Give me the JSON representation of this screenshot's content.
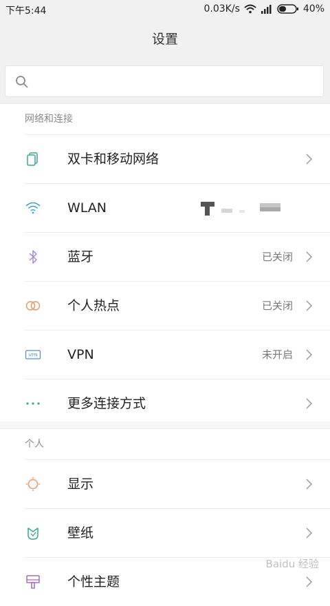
{
  "status_bar": {
    "time": "下午5:44",
    "network_speed": "0.03K/s",
    "battery": "40%"
  },
  "title": "设置",
  "search": {
    "placeholder": ""
  },
  "sections": [
    {
      "header": "网络和连接",
      "items": [
        {
          "label": "双卡和移动网络",
          "value": "",
          "icon": "sim-card-icon",
          "color": "#3fa39a"
        },
        {
          "label": "WLAN",
          "value": "",
          "icon": "wifi-icon",
          "color": "#3fa0c6"
        },
        {
          "label": "蓝牙",
          "value": "已关闭",
          "icon": "bluetooth-icon",
          "color": "#a889d4"
        },
        {
          "label": "个人热点",
          "value": "已关闭",
          "icon": "hotspot-icon",
          "color": "#e9986b"
        },
        {
          "label": "VPN",
          "value": "未开启",
          "icon": "vpn-icon",
          "color": "#5a8fc6"
        },
        {
          "label": "更多连接方式",
          "value": "",
          "icon": "more-dots-icon",
          "color": "#3fa39a"
        }
      ]
    },
    {
      "header": "个人",
      "items": [
        {
          "label": "显示",
          "value": "",
          "icon": "display-sun-icon",
          "color": "#e9986b"
        },
        {
          "label": "壁纸",
          "value": "",
          "icon": "wallpaper-icon",
          "color": "#3fa39a"
        },
        {
          "label": "个性主题",
          "value": "",
          "icon": "theme-brush-icon",
          "color": "#a46db8"
        }
      ]
    }
  ],
  "watermark": "Baidu 经验"
}
